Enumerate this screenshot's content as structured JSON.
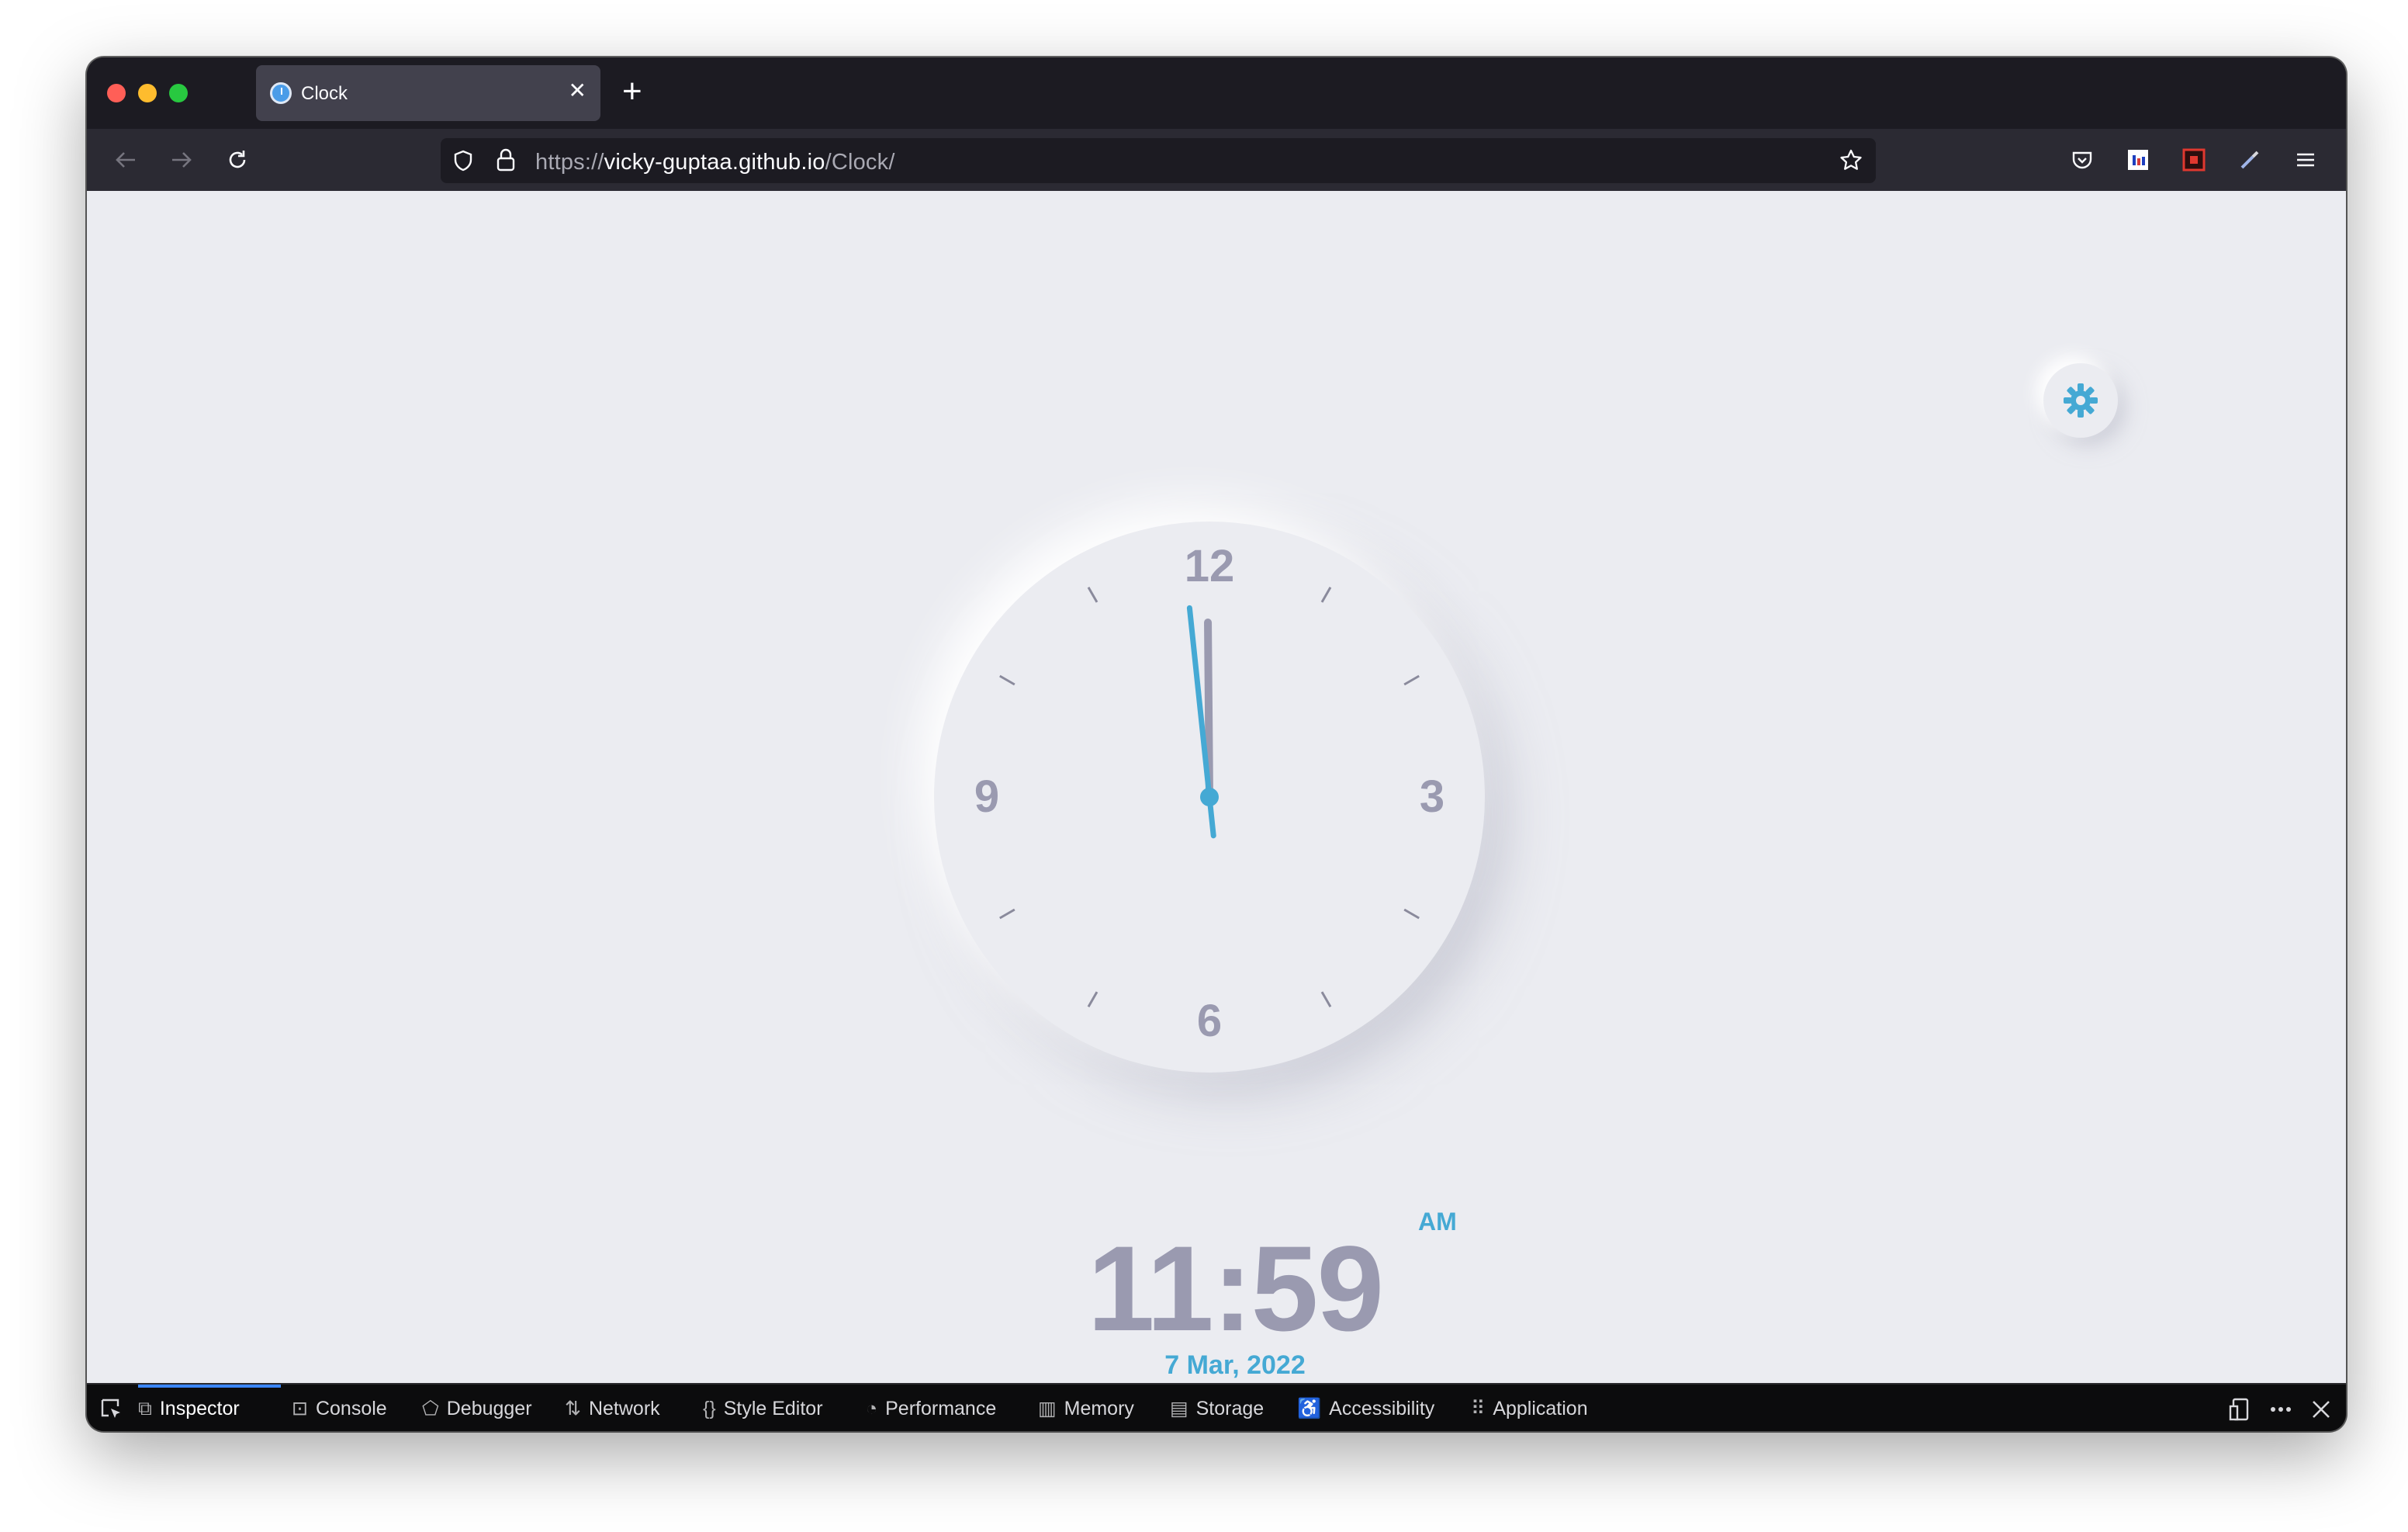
{
  "browser": {
    "tab": {
      "title": "Clock",
      "close_glyph": "✕"
    },
    "new_tab_glyph": "+",
    "url": {
      "scheme": "https://",
      "host": "vicky-guptaa.github.io",
      "path": "/Clock/"
    }
  },
  "clock": {
    "numerals": [
      "12",
      "3",
      "6",
      "9"
    ],
    "hour_hand": {
      "hour": 11,
      "minute": 59
    },
    "minute_hand": {
      "minute": 59
    },
    "accent_color": "#45a9d4",
    "text_color": "#9a9ab0"
  },
  "digital": {
    "time": "11:59",
    "ampm": "AM",
    "date": "7 Mar, 2022"
  },
  "devtools": {
    "tabs": [
      {
        "label": "Inspector",
        "icon": "inspector-icon"
      },
      {
        "label": "Console",
        "icon": "console-icon"
      },
      {
        "label": "Debugger",
        "icon": "debugger-icon"
      },
      {
        "label": "Network",
        "icon": "network-icon"
      },
      {
        "label": "Style Editor",
        "icon": "style-editor-icon"
      },
      {
        "label": "Performance",
        "icon": "performance-icon"
      },
      {
        "label": "Memory",
        "icon": "memory-icon"
      },
      {
        "label": "Storage",
        "icon": "storage-icon"
      },
      {
        "label": "Accessibility",
        "icon": "accessibility-icon"
      },
      {
        "label": "Application",
        "icon": "application-icon"
      }
    ],
    "active_tab": "Inspector"
  }
}
